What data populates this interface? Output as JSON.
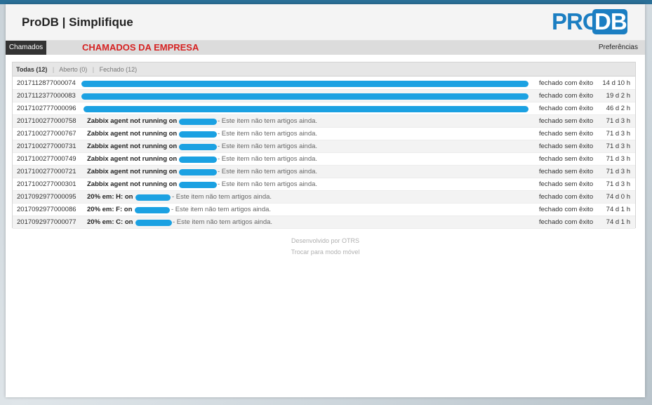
{
  "header": {
    "title": "ProDB | Simplifique",
    "logo_pro": "PRO",
    "logo_db": "DB"
  },
  "nav": {
    "tab_label": "Chamados",
    "company_label": "CHAMADOS DA EMPRESA",
    "preferences_label": "Preferências"
  },
  "filters": {
    "all": "Todas (12)",
    "open": "Aberto (0)",
    "closed": "Fechado (12)"
  },
  "tickets": [
    {
      "number": "2017112877000074",
      "subject": "",
      "preview": "",
      "state": "fechado com êxito",
      "age": "14 d 10 h"
    },
    {
      "number": "2017112377000083",
      "subject": "",
      "preview": "",
      "state": "fechado com êxito",
      "age": "19 d 2 h"
    },
    {
      "number": "2017102777000096",
      "subject": "",
      "preview": "",
      "state": "fechado com êxito",
      "age": "46 d 2 h"
    },
    {
      "number": "2017100277000758",
      "subject": "Zabbix agent not running on",
      "preview": "- Este item não tem artigos ainda.",
      "state": "fechado sem êxito",
      "age": "71 d 3 h"
    },
    {
      "number": "2017100277000767",
      "subject": "Zabbix agent not running on",
      "preview": "- Este item não tem artigos ainda.",
      "state": "fechado sem êxito",
      "age": "71 d 3 h"
    },
    {
      "number": "2017100277000731",
      "subject": "Zabbix agent not running on",
      "preview": "- Este item não tem artigos ainda.",
      "state": "fechado sem êxito",
      "age": "71 d 3 h"
    },
    {
      "number": "2017100277000749",
      "subject": "Zabbix agent not running on",
      "preview": "- Este item não tem artigos ainda.",
      "state": "fechado sem êxito",
      "age": "71 d 3 h"
    },
    {
      "number": "2017100277000721",
      "subject": "Zabbix agent not running on",
      "preview": "- Este item não tem artigos ainda.",
      "state": "fechado sem êxito",
      "age": "71 d 3 h"
    },
    {
      "number": "2017100277000301",
      "subject": "Zabbix agent not running on",
      "preview": "- Este item não tem artigos ainda.",
      "state": "fechado sem êxito",
      "age": "71 d 3 h"
    },
    {
      "number": "2017092977000095",
      "subject": "20% em: H: on",
      "preview": "- Este item não tem artigos ainda.",
      "state": "fechado com êxito",
      "age": "74 d 0 h"
    },
    {
      "number": "2017092977000086",
      "subject": "20% em: F: on",
      "preview": "- Este item não tem artigos ainda.",
      "state": "fechado com êxito",
      "age": "74 d 1 h"
    },
    {
      "number": "2017092977000077",
      "subject": "20% em: C: on",
      "preview": "- Este item não tem artigos ainda.",
      "state": "fechado com êxito",
      "age": "74 d 1 h"
    }
  ],
  "footer": {
    "powered_by": "Desenvolvido por OTRS",
    "mobile_link": "Trocar para modo móvel"
  },
  "colors": {
    "brand": "#1b7ec2",
    "redaction": "#1ba1e2",
    "company_label": "#d62323"
  }
}
